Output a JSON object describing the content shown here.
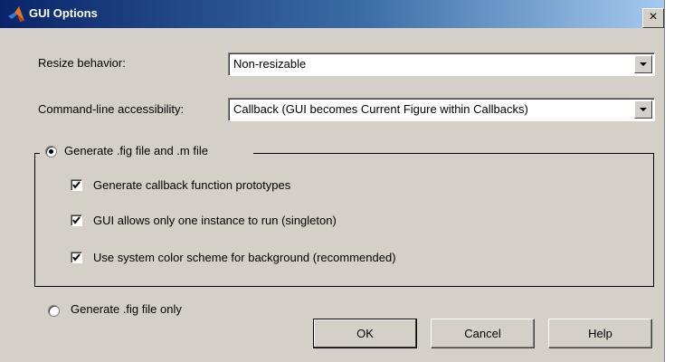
{
  "window": {
    "title": "GUI Options",
    "close_glyph": "×",
    "icon": "matlab-logo-icon"
  },
  "resize": {
    "label": "Resize behavior:",
    "value": "Non-resizable"
  },
  "cmdline": {
    "label": "Command-line accessibility:",
    "value": "Callback (GUI becomes Current Figure within Callbacks)"
  },
  "generate_fig_m": {
    "label": "Generate .fig file and .m file",
    "selected": true
  },
  "options": [
    {
      "label": "Generate callback function prototypes",
      "checked": true
    },
    {
      "label": "GUI allows only one instance to run (singleton)",
      "checked": true
    },
    {
      "label": "Use system color scheme for background (recommended)",
      "checked": true
    }
  ],
  "generate_fig_only": {
    "label": "Generate .fig file only",
    "selected": false
  },
  "buttons": {
    "ok": "OK",
    "cancel": "Cancel",
    "help": "Help"
  }
}
